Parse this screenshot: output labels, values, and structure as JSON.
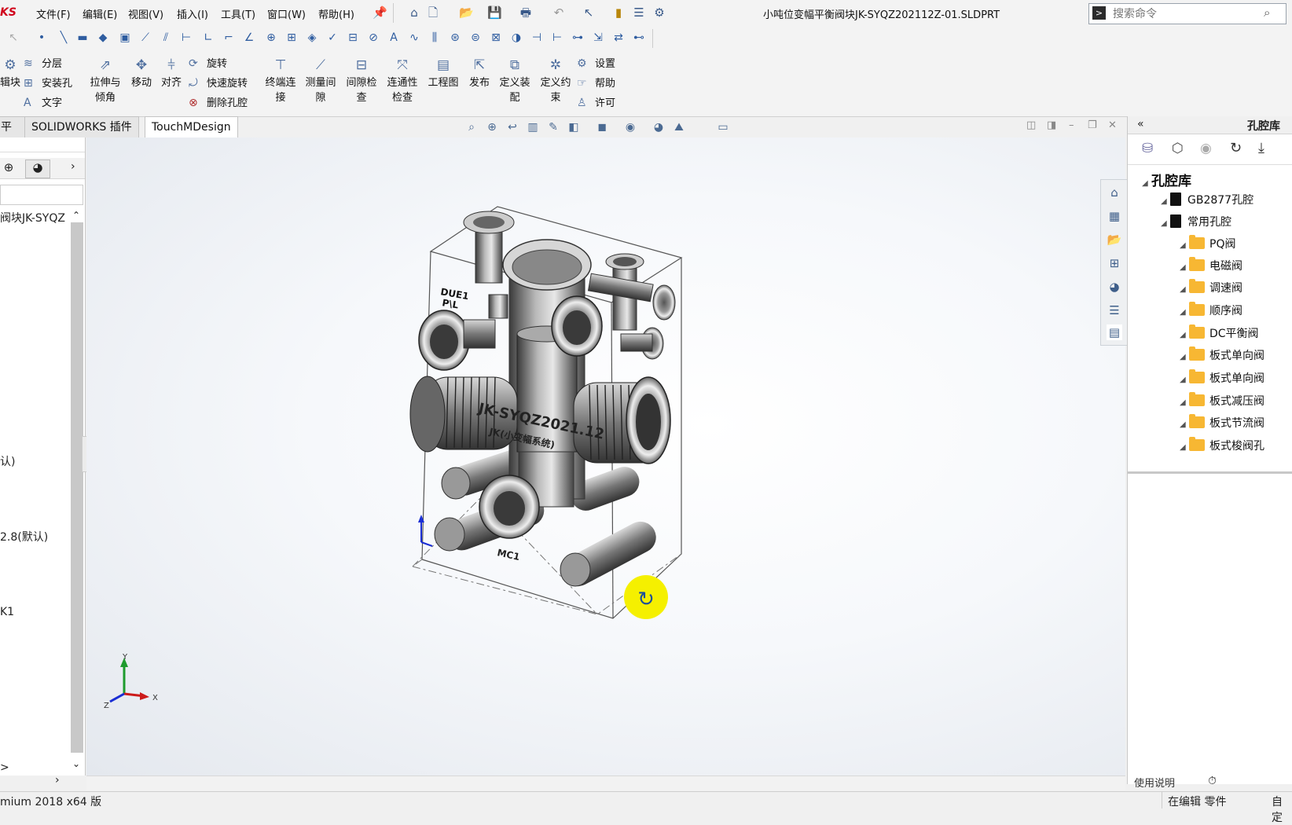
{
  "app": {
    "logo_fragment": "KS",
    "window_title": "小吨位变幅平衡阀块JK-SYQZ202112Z-01.SLDPRT"
  },
  "menu": [
    "文件(F)",
    "编辑(E)",
    "视图(V)",
    "插入(I)",
    "工具(T)",
    "窗口(W)",
    "帮助(H)"
  ],
  "search": {
    "placeholder": "搜索命令"
  },
  "ribbon": {
    "left_fragment": "辑块",
    "group_small_1": [
      "分层",
      "安装孔",
      "文字"
    ],
    "buttons": [
      {
        "l1": "拉伸与",
        "l2": "倾角"
      },
      {
        "l1": "移动",
        "l2": ""
      },
      {
        "l1": "对齐",
        "l2": ""
      }
    ],
    "group_small_2": [
      "旋转",
      "快速旋转",
      "删除孔腔"
    ],
    "buttons2": [
      {
        "l1": "终端连",
        "l2": "接"
      },
      {
        "l1": "测量间",
        "l2": "隙"
      },
      {
        "l1": "间隙检",
        "l2": "查"
      },
      {
        "l1": "连通性",
        "l2": "检查"
      },
      {
        "l1": "工程图",
        "l2": ""
      },
      {
        "l1": "发布",
        "l2": ""
      },
      {
        "l1": "定义装",
        "l2": "配"
      },
      {
        "l1": "定义约",
        "l2": "束"
      }
    ],
    "group_small_3": [
      "设置",
      "帮助",
      "许可"
    ]
  },
  "tabs": [
    "平估",
    "SOLIDWORKS 插件",
    "TouchMDesign"
  ],
  "left_panel": {
    "root_fragment": "阀块JK-SYQZ",
    "fragments": [
      "认)",
      "2.8(默认)",
      "K1",
      ">"
    ]
  },
  "viewport": {
    "model_labels": [
      "DUE1",
      "P\\L",
      "JK-SYQZ2021.12",
      "JK(小变幅系统)",
      "MC1"
    ],
    "axes": [
      "Y",
      "X",
      "Z"
    ]
  },
  "right_panel": {
    "title": "孔腔库",
    "root": "孔腔库",
    "groups": [
      {
        "label": "GB2877孔腔",
        "children": []
      },
      {
        "label": "常用孔腔",
        "children": [
          "PQ阀",
          "电磁阀",
          "调速阀",
          "顺序阀",
          "DC平衡阀",
          "板式单向阀",
          "板式单向阀",
          "板式减压阀",
          "板式节流阀",
          "板式梭阀孔"
        ]
      }
    ],
    "footer_fragment": "使用说明"
  },
  "status": {
    "left": "mium 2018 x64 版",
    "right": "在编辑 零件",
    "far_right": "自定"
  },
  "colors": {
    "accent": "#2f5da0",
    "folder": "#f7b733",
    "cursor_highlight": "#f5f000"
  }
}
